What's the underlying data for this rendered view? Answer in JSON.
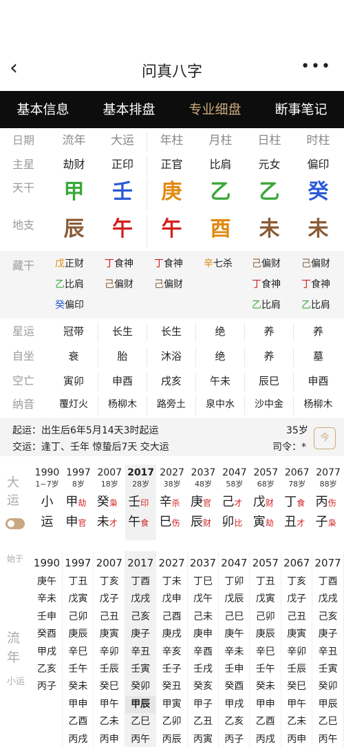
{
  "header": {
    "back_icon": "chevron-left-icon",
    "title": "问真八字",
    "more_icon": "more-icon"
  },
  "tabs": [
    "基本信息",
    "基本排盘",
    "专业细盘",
    "断事笔记"
  ],
  "pillars": {
    "labels": {
      "date": "日期",
      "star": "主星",
      "tg": "天干",
      "dz": "地支"
    },
    "cols": [
      "流年",
      "大运",
      "年柱",
      "月柱",
      "日柱",
      "时柱"
    ],
    "stars": [
      "劫财",
      "正印",
      "正官",
      "比肩",
      "元女",
      "偏印"
    ],
    "tiangan": [
      "甲",
      "壬",
      "庚",
      "乙",
      "乙",
      "癸"
    ],
    "dizhi": [
      "辰",
      "午",
      "午",
      "酉",
      "未",
      "未"
    ]
  },
  "canggan": {
    "label": "藏干",
    "items": [
      [
        {
          "g": "戊",
          "s": "正财"
        },
        {
          "g": "乙",
          "s": "比肩"
        },
        {
          "g": "癸",
          "s": "偏印"
        }
      ],
      [
        {
          "g": "丁",
          "s": "食神"
        },
        {
          "g": "己",
          "s": "偏财"
        }
      ],
      [
        {
          "g": "丁",
          "s": "食神"
        },
        {
          "g": "己",
          "s": "偏财"
        }
      ],
      [
        {
          "g": "辛",
          "s": "七杀"
        }
      ],
      [
        {
          "g": "己",
          "s": "偏财"
        },
        {
          "g": "丁",
          "s": "食神"
        },
        {
          "g": "乙",
          "s": "比肩"
        }
      ],
      [
        {
          "g": "己",
          "s": "偏财"
        },
        {
          "g": "丁",
          "s": "食神"
        },
        {
          "g": "乙",
          "s": "比肩"
        }
      ]
    ]
  },
  "extra": {
    "labels": [
      "星运",
      "自坐",
      "空亡",
      "纳音"
    ],
    "rows": [
      [
        "冠带",
        "长生",
        "长生",
        "绝",
        "养",
        "养"
      ],
      [
        "衰",
        "胎",
        "沐浴",
        "绝",
        "养",
        "墓"
      ],
      [
        "寅卯",
        "申酉",
        "戌亥",
        "午未",
        "辰巳",
        "申酉"
      ],
      [
        "覆灯火",
        "杨柳木",
        "路旁土",
        "泉中水",
        "沙中金",
        "杨柳木"
      ]
    ]
  },
  "qiyun": {
    "line1": "起运：出生后6年5月14天3时起运",
    "line2": "交运：逢丁、壬年 惊蛰后7天 交大运",
    "age": "35岁",
    "siling": "司令：*",
    "cal_label": "今"
  },
  "dayun": {
    "label": "大运",
    "cols": [
      {
        "y": "1990",
        "a": "1~7岁",
        "g1": "小",
        "g2": "运",
        "s1": "",
        "s2": ""
      },
      {
        "y": "1997",
        "a": "8岁",
        "g1": "甲",
        "s1": "劫",
        "g2": "申",
        "s2": "官"
      },
      {
        "y": "2007",
        "a": "18岁",
        "g1": "癸",
        "s1": "枭",
        "g2": "未",
        "s2": "才"
      },
      {
        "y": "2017",
        "a": "28岁",
        "g1": "壬",
        "s1": "印",
        "g2": "午",
        "s2": "食"
      },
      {
        "y": "2027",
        "a": "38岁",
        "g1": "辛",
        "s1": "杀",
        "g2": "巳",
        "s2": "伤"
      },
      {
        "y": "2037",
        "a": "48岁",
        "g1": "庚",
        "s1": "官",
        "g2": "辰",
        "s2": "财"
      },
      {
        "y": "2047",
        "a": "58岁",
        "g1": "己",
        "s1": "才",
        "g2": "卯",
        "s2": "比"
      },
      {
        "y": "2057",
        "a": "68岁",
        "g1": "戊",
        "s1": "财",
        "g2": "寅",
        "s2": "劫"
      },
      {
        "y": "2067",
        "a": "78岁",
        "g1": "丁",
        "s1": "食",
        "g2": "丑",
        "s2": "才"
      },
      {
        "y": "2077",
        "a": "88岁",
        "g1": "丙",
        "s1": "伤",
        "g2": "子",
        "s2": "枭"
      }
    ]
  },
  "liunian": {
    "start_label": "始于",
    "label": "流年",
    "sub": "小运",
    "cols": [
      {
        "y": "1990",
        "i": [
          "庚午",
          "辛未",
          "壬申",
          "癸酉",
          "甲戌",
          "乙亥",
          "丙子",
          "",
          "",
          ""
        ]
      },
      {
        "y": "1997",
        "i": [
          "丁丑",
          "戊寅",
          "己卯",
          "庚辰",
          "辛巳",
          "壬午",
          "癸未",
          "甲申",
          "乙酉",
          "丙戌"
        ]
      },
      {
        "y": "2007",
        "i": [
          "丁亥",
          "戊子",
          "己丑",
          "庚寅",
          "辛卯",
          "壬辰",
          "癸巳",
          "甲午",
          "乙未",
          "丙申"
        ]
      },
      {
        "y": "2017",
        "i": [
          "丁酉",
          "戊戌",
          "己亥",
          "庚子",
          "辛丑",
          "壬寅",
          "癸卯",
          "甲辰",
          "乙巳",
          "丙午"
        ]
      },
      {
        "y": "2027",
        "i": [
          "丁未",
          "戊申",
          "己酉",
          "庚戌",
          "辛亥",
          "壬子",
          "癸丑",
          "甲寅",
          "乙卯",
          "丙辰"
        ]
      },
      {
        "y": "2037",
        "i": [
          "丁巳",
          "戊午",
          "己未",
          "庚申",
          "辛酉",
          "壬戌",
          "癸亥",
          "甲子",
          "乙丑",
          "丙寅"
        ]
      },
      {
        "y": "2047",
        "i": [
          "丁卯",
          "戊辰",
          "己巳",
          "庚午",
          "辛未",
          "壬申",
          "癸酉",
          "甲戌",
          "乙亥",
          "丙子"
        ]
      },
      {
        "y": "2057",
        "i": [
          "丁丑",
          "戊寅",
          "己卯",
          "庚辰",
          "辛巳",
          "壬午",
          "癸未",
          "甲申",
          "乙酉",
          "丙戌"
        ]
      },
      {
        "y": "2067",
        "i": [
          "丁亥",
          "戊子",
          "己丑",
          "庚寅",
          "辛卯",
          "壬辰",
          "癸巳",
          "甲午",
          "乙未",
          "丙申"
        ]
      },
      {
        "y": "2077",
        "i": [
          "丁酉",
          "戊戌",
          "己亥",
          "庚子",
          "辛丑",
          "壬寅",
          "癸卯",
          "甲辰",
          "乙巳",
          "丙午"
        ]
      }
    ]
  }
}
